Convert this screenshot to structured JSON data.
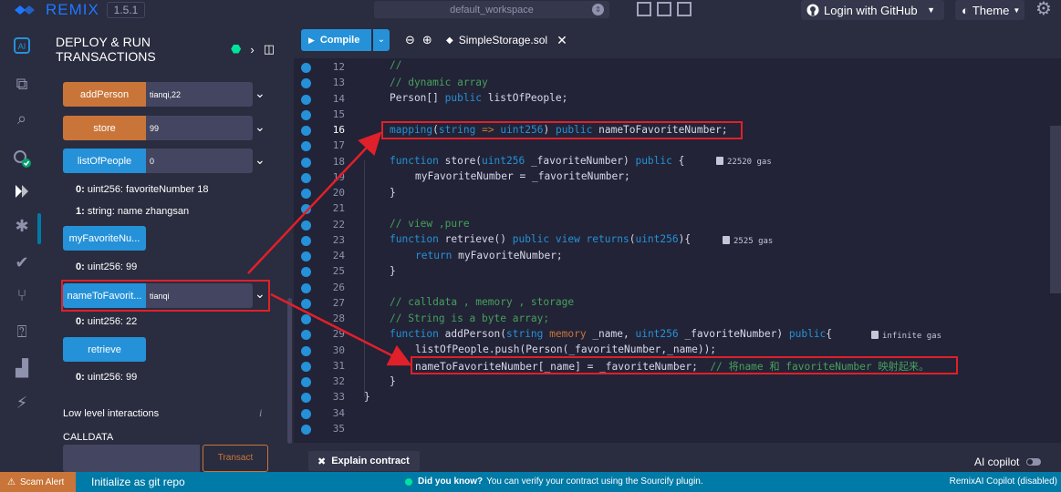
{
  "topbar": {
    "logo": "REMIX",
    "version": "1.5.1",
    "workspace": "default_workspace",
    "login": "Login with GitHub",
    "theme": "Theme"
  },
  "panel": {
    "title_line1": "DEPLOY & RUN",
    "title_line2": "TRANSACTIONS",
    "functions": [
      {
        "label": "addPerson",
        "value": "tianqi,22"
      },
      {
        "label": "store",
        "value": "99"
      },
      {
        "label": "listOfPeople",
        "value": "0"
      }
    ],
    "list_out_0_key": "0:",
    "list_out_0_val": "uint256: favoriteNumber 18",
    "list_out_1_key": "1:",
    "list_out_1_val": "string: name zhangsan",
    "myfav_label": "myFavoriteNu...",
    "myfav_out_key": "0:",
    "myfav_out_val": "uint256: 99",
    "name_fn_label": "nameToFavorit...",
    "name_fn_value": "tianqi",
    "name_out_key": "0:",
    "name_out_val": "uint256: 22",
    "retrieve_label": "retrieve",
    "retrieve_out_key": "0:",
    "retrieve_out_val": "uint256: 99",
    "low_level": "Low level interactions",
    "calldata": "CALLDATA",
    "transact": "Transact"
  },
  "editor": {
    "compile": "Compile",
    "file": "SimpleStorage.sol",
    "line_numbers": [
      "12",
      "13",
      "14",
      "15",
      "16",
      "17",
      "18",
      "19",
      "20",
      "21",
      "22",
      "23",
      "24",
      "25",
      "26",
      "27",
      "28",
      "29",
      "30",
      "31",
      "32",
      "33",
      "34",
      "35"
    ],
    "current_line": "16",
    "gas": {
      "store": "22520 gas",
      "retrieve": "2525 gas",
      "addPerson": "infinite gas"
    }
  },
  "explain": {
    "button": "Explain contract",
    "copilot": "AI copilot"
  },
  "status": {
    "scam": "Scam Alert",
    "git": "Initialize as git repo",
    "tip_title": "Did you know?",
    "tip_text": "You can verify your contract using the Sourcify plugin.",
    "ai": "RemixAI Copilot (disabled)"
  },
  "colors": {
    "accent_blue": "#2591d8",
    "accent_orange": "#c97539",
    "highlight_red": "#e0202a",
    "status_bar": "#007aa6"
  }
}
